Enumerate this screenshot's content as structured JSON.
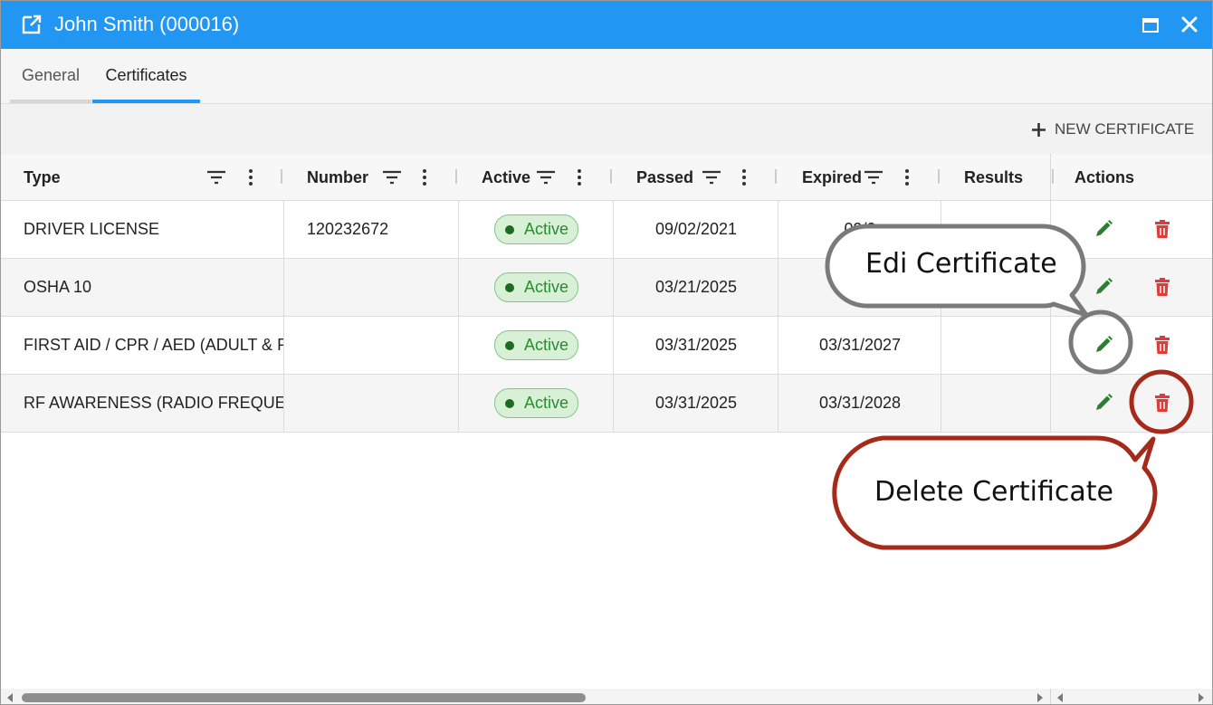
{
  "window": {
    "title": "John Smith (000016)"
  },
  "tabs": [
    {
      "label": "General"
    },
    {
      "label": "Certificates"
    }
  ],
  "toolbar": {
    "new_certificate_label": "NEW CERTIFICATE"
  },
  "columns": {
    "type": "Type",
    "number": "Number",
    "active": "Active",
    "passed": "Passed",
    "expired": "Expired",
    "results": "Results",
    "actions": "Actions"
  },
  "rows": [
    {
      "type": "DRIVER LICENSE",
      "number": "120232672",
      "active": "Active",
      "passed": "09/02/2021",
      "expired": "09/0",
      "results": ""
    },
    {
      "type": "OSHA 10",
      "number": "",
      "active": "Active",
      "passed": "03/21/2025",
      "expired": "0",
      "results": ""
    },
    {
      "type": "FIRST AID / CPR / AED (ADULT & P",
      "number": "",
      "active": "Active",
      "passed": "03/31/2025",
      "expired": "03/31/2027",
      "results": ""
    },
    {
      "type": "RF AWARENESS (RADIO FREQUENC",
      "number": "",
      "active": "Active",
      "passed": "03/31/2025",
      "expired": "03/31/2028",
      "results": ""
    }
  ],
  "callouts": {
    "edit": "Edi Certificate",
    "delete": "Delete Certificate"
  },
  "colors": {
    "accent": "#2196f3",
    "active_badge_bg": "#d8f0d6",
    "active_badge_text": "#2e8a30",
    "edit_icon": "#2e7d32",
    "delete_icon": "#e53935",
    "callout_edit_border": "#7a7a7a",
    "callout_delete_border": "#a52a1a"
  },
  "icons": {
    "title": "open-in-new-icon",
    "maximize": "maximize-icon",
    "close": "close-icon",
    "new": "plus-icon",
    "filter": "filter-icon",
    "column_menu": "more-vertical-icon",
    "edit": "pencil-icon",
    "delete": "trash-icon"
  }
}
